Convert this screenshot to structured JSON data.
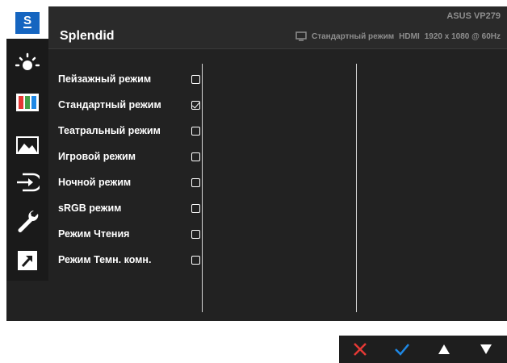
{
  "header": {
    "title": "Splendid",
    "model": "ASUS VP279",
    "current_mode": "Стандартный режим",
    "input": "HDMI",
    "resolution": "1920 x 1080 @ 60Hz"
  },
  "sidebar": {
    "items": [
      {
        "icon": "splendid-s-icon",
        "label": "S",
        "active": true
      },
      {
        "icon": "brightness-icon"
      },
      {
        "icon": "color-bars-icon"
      },
      {
        "icon": "image-icon"
      },
      {
        "icon": "input-select-icon"
      },
      {
        "icon": "system-setup-wrench-icon"
      },
      {
        "icon": "shortcut-arrow-icon"
      }
    ]
  },
  "menu": {
    "items": [
      {
        "label": "Пейзажный режим",
        "checked": false
      },
      {
        "label": "Стандартный режим",
        "checked": true
      },
      {
        "label": "Театральный режим",
        "checked": false
      },
      {
        "label": "Игровой режим",
        "checked": false
      },
      {
        "label": "Ночной режим",
        "checked": false
      },
      {
        "label": "sRGB режим",
        "checked": false
      },
      {
        "label": "Режим Чтения",
        "checked": false
      },
      {
        "label": "Режим Темн. комн.",
        "checked": false
      }
    ]
  },
  "nav": {
    "buttons": [
      {
        "icon": "close-icon",
        "color": "#e53935"
      },
      {
        "icon": "check-icon",
        "color": "#1e88e5"
      },
      {
        "icon": "up-arrow-icon",
        "color": "#ffffff"
      },
      {
        "icon": "down-arrow-icon",
        "color": "#ffffff"
      }
    ]
  }
}
